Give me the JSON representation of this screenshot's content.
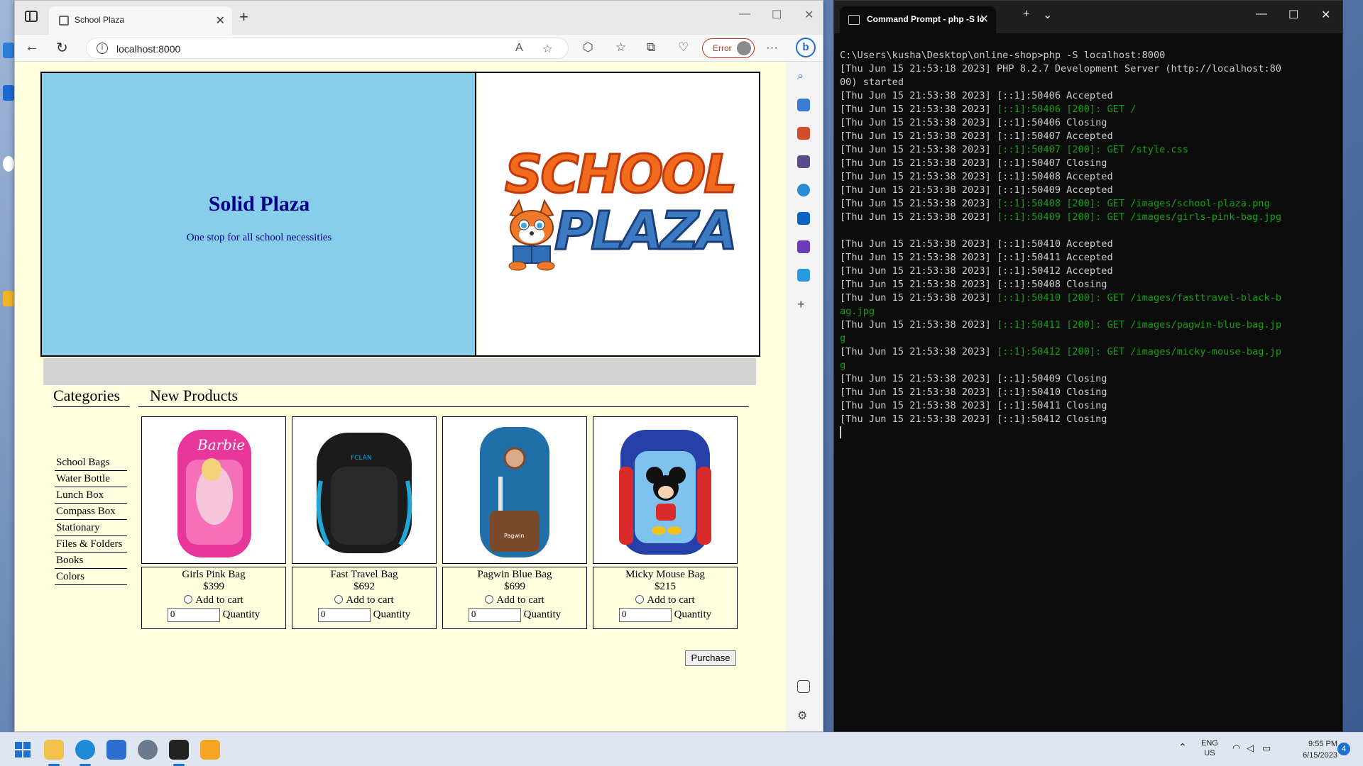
{
  "browser": {
    "tab_title": "School Plaza",
    "url": "localhost:8000",
    "error_label": "Error"
  },
  "page": {
    "site_title": "Solid Plaza",
    "tagline": "One stop for all school necessities",
    "logo_text_top": "SCHOOL",
    "logo_text_bottom": "PLAZA",
    "categories_heading": "Categories",
    "products_heading": "New Products",
    "categories": [
      "School Bags",
      "Water Bottle",
      "Lunch Box",
      "Compass Box",
      "Stationary",
      "Files & Folders",
      "Books",
      "Colors"
    ],
    "products": [
      {
        "name": "Girls Pink Bag",
        "price": "$399",
        "cart_label": "Add to cart",
        "qty": "0",
        "qty_label": "Quantity"
      },
      {
        "name": "Fast Travel Bag",
        "price": "$692",
        "cart_label": "Add to cart",
        "qty": "0",
        "qty_label": "Quantity"
      },
      {
        "name": "Pagwin Blue Bag",
        "price": "$699",
        "cart_label": "Add to cart",
        "qty": "0",
        "qty_label": "Quantity"
      },
      {
        "name": "Micky Mouse Bag",
        "price": "$215",
        "cart_label": "Add to cart",
        "qty": "0",
        "qty_label": "Quantity"
      }
    ],
    "purchase_label": "Purchase"
  },
  "terminal": {
    "tab_title": "Command Prompt - php -S lc",
    "lines": [
      {
        "pre": "C:\\Users\\kusha\\Desktop\\online-shop>php -S localhost:8000",
        "green": "",
        "post": ""
      },
      {
        "pre": "[Thu Jun 15 21:53:18 2023] PHP 8.2.7 Development Server (http://localhost:80",
        "green": "",
        "post": ""
      },
      {
        "pre": "00) started",
        "green": "",
        "post": ""
      },
      {
        "pre": "[Thu Jun 15 21:53:38 2023] [::1]:50406 Accepted",
        "green": "",
        "post": ""
      },
      {
        "pre": "[Thu Jun 15 21:53:38 2023] ",
        "green": "[::1]:50406 [200]: GET /",
        "post": ""
      },
      {
        "pre": "[Thu Jun 15 21:53:38 2023] [::1]:50406 Closing",
        "green": "",
        "post": ""
      },
      {
        "pre": "[Thu Jun 15 21:53:38 2023] [::1]:50407 Accepted",
        "green": "",
        "post": ""
      },
      {
        "pre": "[Thu Jun 15 21:53:38 2023] ",
        "green": "[::1]:50407 [200]: GET /style.css",
        "post": ""
      },
      {
        "pre": "[Thu Jun 15 21:53:38 2023] [::1]:50407 Closing",
        "green": "",
        "post": ""
      },
      {
        "pre": "[Thu Jun 15 21:53:38 2023] [::1]:50408 Accepted",
        "green": "",
        "post": ""
      },
      {
        "pre": "[Thu Jun 15 21:53:38 2023] [::1]:50409 Accepted",
        "green": "",
        "post": ""
      },
      {
        "pre": "[Thu Jun 15 21:53:38 2023] ",
        "green": "[::1]:50408 [200]: GET /images/school-plaza.png",
        "post": ""
      },
      {
        "pre": "[Thu Jun 15 21:53:38 2023] ",
        "green": "[::1]:50409 [200]: GET /images/girls-pink-bag.jpg",
        "post": ""
      },
      {
        "pre": "",
        "green": "",
        "post": ""
      },
      {
        "pre": "[Thu Jun 15 21:53:38 2023] [::1]:50410 Accepted",
        "green": "",
        "post": ""
      },
      {
        "pre": "[Thu Jun 15 21:53:38 2023] [::1]:50411 Accepted",
        "green": "",
        "post": ""
      },
      {
        "pre": "[Thu Jun 15 21:53:38 2023] [::1]:50412 Accepted",
        "green": "",
        "post": ""
      },
      {
        "pre": "[Thu Jun 15 21:53:38 2023] [::1]:50408 Closing",
        "green": "",
        "post": ""
      },
      {
        "pre": "[Thu Jun 15 21:53:38 2023] ",
        "green": "[::1]:50410 [200]: GET /images/fasttravel-black-b",
        "post": ""
      },
      {
        "pre": "",
        "green": "ag.jpg",
        "post": ""
      },
      {
        "pre": "[Thu Jun 15 21:53:38 2023] ",
        "green": "[::1]:50411 [200]: GET /images/pagwin-blue-bag.jp",
        "post": ""
      },
      {
        "pre": "",
        "green": "g",
        "post": ""
      },
      {
        "pre": "[Thu Jun 15 21:53:38 2023] ",
        "green": "[::1]:50412 [200]: GET /images/micky-mouse-bag.jp",
        "post": ""
      },
      {
        "pre": "",
        "green": "g",
        "post": ""
      },
      {
        "pre": "[Thu Jun 15 21:53:38 2023] [::1]:50409 Closing",
        "green": "",
        "post": ""
      },
      {
        "pre": "[Thu Jun 15 21:53:38 2023] [::1]:50410 Closing",
        "green": "",
        "post": ""
      },
      {
        "pre": "[Thu Jun 15 21:53:38 2023] [::1]:50411 Closing",
        "green": "",
        "post": ""
      },
      {
        "pre": "[Thu Jun 15 21:53:38 2023] [::1]:50412 Closing",
        "green": "",
        "post": ""
      }
    ]
  },
  "taskbar": {
    "lang_top": "ENG",
    "lang_bottom": "US",
    "time": "9:55 PM",
    "date": "6/15/2023",
    "notification_count": "4"
  }
}
